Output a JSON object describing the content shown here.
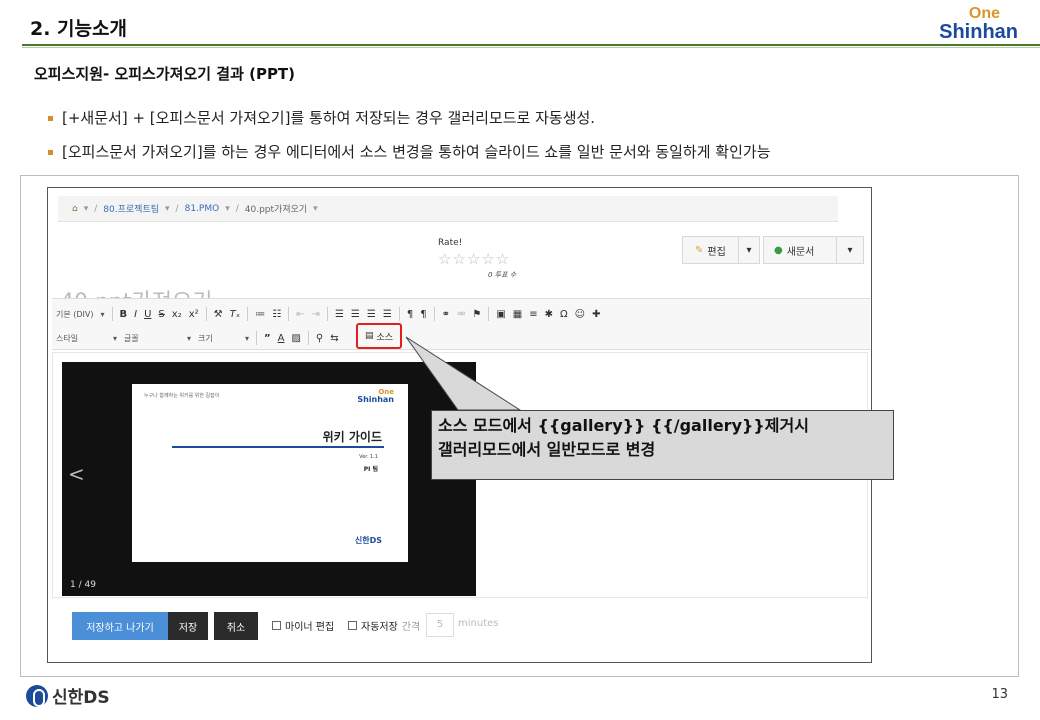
{
  "header": {
    "title": "2. 기능소개",
    "logo_one": "One",
    "logo_shinhan": "Shinhan"
  },
  "subtitle": "오피스지원- 오피스가져오기 결과 (PPT)",
  "bullets": [
    "[+새문서] + [오피스문서 가져오기]를 통하여 저장되는 경우 갤러리모드로 자동생성.",
    "[오피스문서 가져오기]를 하는 경우  에디터에서 소스 변경을 통하여 슬라이드 쇼를 일반 문서와 동일하게 확인가능"
  ],
  "screenshot": {
    "breadcrumb": [
      "80.프로젝트팀",
      "81.PMO",
      "40.ppt가져오기"
    ],
    "rate_label": "Rate!",
    "stars": "☆☆☆☆☆",
    "votes": "0 투표 수",
    "edit_label": "편집",
    "new_doc_label": "새문서",
    "page_heading": "40.ppt가져오기",
    "toolbar": {
      "row1_format": "기본 (DIV)",
      "row2_style": "스타일",
      "row2_font": "글꼴",
      "row2_size": "크기",
      "source_label": "소스"
    },
    "slide": {
      "topline": "누구나 함께하는 위키를 위한 길잡이",
      "logo_one": "One",
      "logo_shinhan": "Shinhan",
      "title": "위키 가이드",
      "version": "Ver. 1.1",
      "team": "PI 팀",
      "brand": "신한DS",
      "prev": "<",
      "counter": "1 / 49"
    },
    "footer": {
      "save_exit": "저장하고 나가기",
      "save": "저장",
      "cancel": "취소",
      "minor_edit": "마이너 편집",
      "autosave": "자동저장",
      "interval": "간격",
      "interval_value": "5",
      "minutes": "minutes"
    }
  },
  "callout": {
    "line1": "소스 모드에서 {{gallery}} {{/gallery}}제거시",
    "line2": "갤러리모드에서 일반모드로 변경"
  },
  "footer": {
    "brand": "신한DS",
    "page_number": "13"
  },
  "colors": {
    "accent_green": "#4a7a2e",
    "bullet_orange": "#d98b2a",
    "brand_blue": "#1b4b9a",
    "highlight_red": "#e02020"
  }
}
